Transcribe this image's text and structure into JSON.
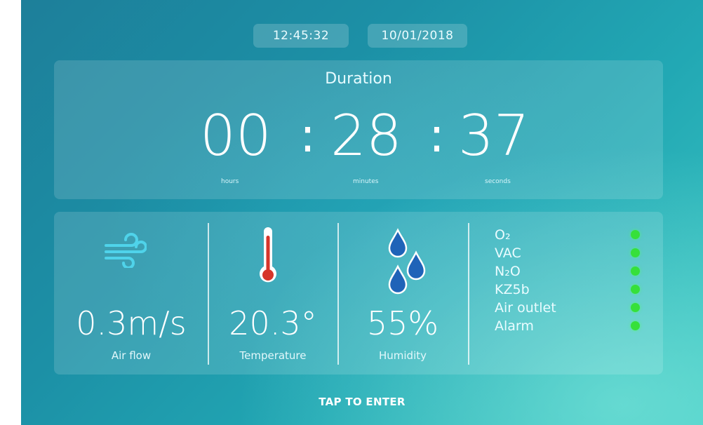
{
  "header": {
    "time": "12:45:32",
    "date": "10/01/2018"
  },
  "duration": {
    "title": "Duration",
    "hours": "00",
    "minutes": "28",
    "seconds": "37",
    "separator": ":",
    "hours_label": "hours",
    "minutes_label": "minutes",
    "seconds_label": "seconds"
  },
  "metrics": {
    "airflow": {
      "value": "0.3m/s",
      "label": "Air flow",
      "icon": "wind-icon"
    },
    "temperature": {
      "value": "20.3°",
      "label": "Temperature",
      "icon": "thermometer-icon"
    },
    "humidity": {
      "value": "55%",
      "label": "Humidity",
      "icon": "water-drops-icon"
    }
  },
  "status": {
    "items": [
      {
        "label": "O₂",
        "state": "ok"
      },
      {
        "label": "VAC",
        "state": "ok"
      },
      {
        "label": "N₂O",
        "state": "ok"
      },
      {
        "label": "KZ5b",
        "state": "ok"
      },
      {
        "label": "Air outlet",
        "state": "ok"
      },
      {
        "label": "Alarm",
        "state": "ok"
      }
    ],
    "ok_color": "#36e03a"
  },
  "footer": {
    "tap_label": "TAP TO ENTER"
  },
  "colors": {
    "accent_icon": "#4fd3ea",
    "thermo_red": "#d6352a",
    "drop_blue": "#1f63b8"
  }
}
